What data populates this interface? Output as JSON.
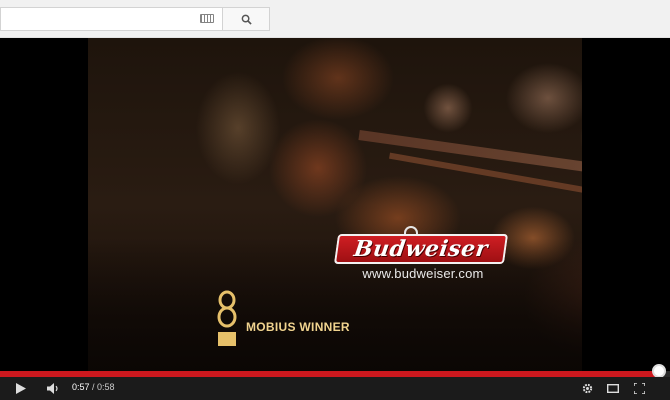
{
  "search": {
    "value": "",
    "placeholder": ""
  },
  "video": {
    "brand_name": "Budweiser",
    "url_text": "www.budweiser.com",
    "award_text": "MOBIUS WINNER"
  },
  "player": {
    "current_time": "0:57",
    "separator": " / ",
    "duration": "0:58",
    "progress_fraction": 0.983,
    "accent_color": "#cc181e"
  },
  "icons": [
    "keyboard-icon",
    "search-icon",
    "play-icon",
    "volume-icon",
    "settings-icon",
    "theater-mode-icon",
    "fullscreen-icon"
  ]
}
